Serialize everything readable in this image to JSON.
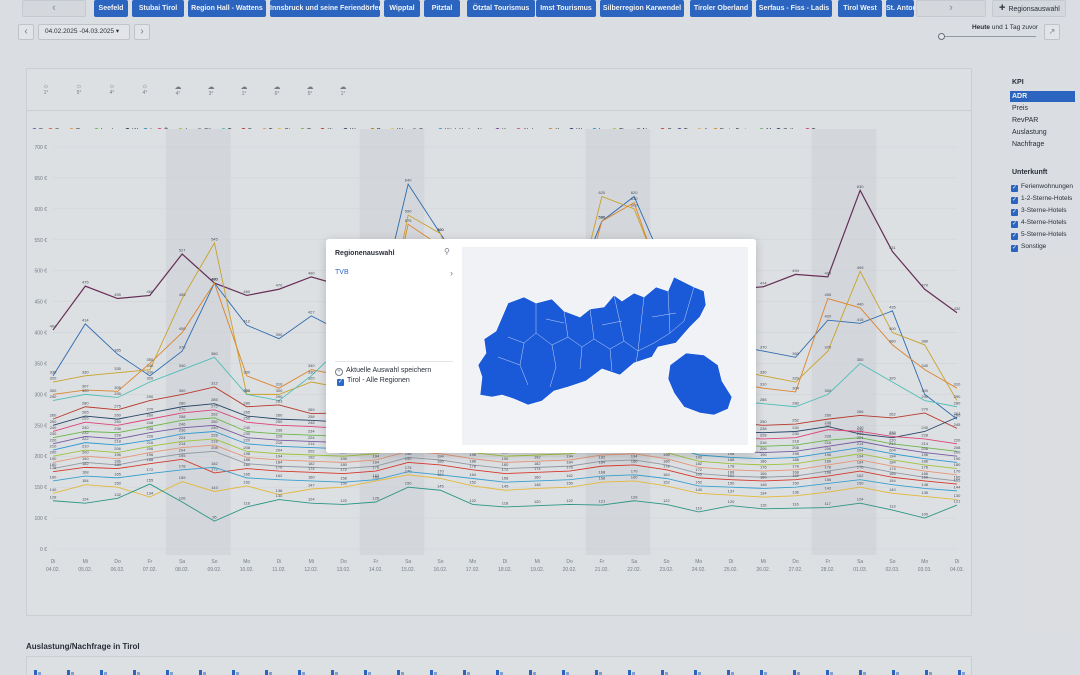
{
  "region_bar": {
    "prev_arrow": "‹",
    "next_arrow": "›",
    "regions": [
      "Seefeld",
      "Stubai Tirol",
      "Region Hall - Wattens",
      "Innsbruck und seine Feriendörfer",
      "Wipptal",
      "Pitztal",
      "Ötztal Tourismus",
      "Imst Tourismus",
      "Silberregion Karwendel",
      "Tiroler Oberland",
      "Serfaus - Fiss - Ladis",
      "Tirol West",
      "St. Anton"
    ],
    "add_button_label": "Regionsauswahl"
  },
  "date_nav": {
    "range_label": "04.02.2025 -04.03.2025",
    "prev": "‹",
    "next": "›"
  },
  "slider": {
    "label_bold": "Heute",
    "label_rest": " und 1 Tag zuvor",
    "value": 0
  },
  "weather": [
    {
      "icon": "☼",
      "temp": "1°"
    },
    {
      "icon": "☼",
      "temp": "5°"
    },
    {
      "icon": "☼",
      "temp": "4°"
    },
    {
      "icon": "☼",
      "temp": "4°"
    },
    {
      "icon": "☁",
      "temp": "4°"
    },
    {
      "icon": "☁",
      "temp": "3°"
    },
    {
      "icon": "☁",
      "temp": "1°"
    },
    {
      "icon": "☁",
      "temp": "6°"
    },
    {
      "icon": "☁",
      "temp": "5°"
    },
    {
      "icon": "☁",
      "temp": "1°"
    }
  ],
  "legend": [
    {
      "label": "E",
      "color": "#7b5ea7"
    },
    {
      "label": "S...",
      "color": "#e8603c"
    },
    {
      "label": "Re...",
      "color": "#f0a236"
    },
    {
      "label": "Innsb...",
      "color": "#6fbf4a"
    },
    {
      "label": "W",
      "color": "#27466b"
    },
    {
      "label": "I",
      "color": "#2f8fd0"
    },
    {
      "label": "Ö...",
      "color": "#e8467c"
    },
    {
      "label": "I...",
      "color": "#a6cc3a"
    },
    {
      "label": "Sil...",
      "color": "#9aa0ab"
    },
    {
      "label": "T...",
      "color": "#53c7c2"
    },
    {
      "label": "S...",
      "color": "#c0392b"
    },
    {
      "label": "T",
      "color": "#f29c7a"
    },
    {
      "label": "St...",
      "color": "#f0c13a"
    },
    {
      "label": "P...",
      "color": "#7fbf3f"
    },
    {
      "label": "Ki...",
      "color": "#c23b22"
    },
    {
      "label": "Kitz...",
      "color": "#3a4a7a"
    },
    {
      "label": "P...",
      "color": "#b8860b"
    },
    {
      "label": "W...",
      "color": "#e6d44a"
    },
    {
      "label": "Fer...",
      "color": "#9aa0ab"
    },
    {
      "label": "Kitzbüheler Alp...",
      "color": "#3aa6d8"
    },
    {
      "label": "K...",
      "color": "#7a3fb0"
    },
    {
      "label": "Alpba...",
      "color": "#e05a8a"
    },
    {
      "label": "K...",
      "color": "#e08a2c"
    },
    {
      "label": "W...",
      "color": "#243b7a"
    },
    {
      "label": "L...",
      "color": "#2fa0d8"
    },
    {
      "label": "Tir...",
      "color": "#b6d23a"
    },
    {
      "label": "Na...",
      "color": "#7a8390"
    },
    {
      "label": "O",
      "color": "#e0392b"
    },
    {
      "label": "T...",
      "color": "#5b4fa8"
    },
    {
      "label": "A",
      "color": "#f4b860"
    },
    {
      "label": "Erste Ferie...",
      "color": "#f08a24"
    },
    {
      "label": "M",
      "color": "#6cbf6a"
    },
    {
      "label": "Zell ...",
      "color": "#2d4a78"
    },
    {
      "label": "T...",
      "color": "#e0407c"
    }
  ],
  "chart_data": {
    "type": "line",
    "title": "",
    "xlabel": "",
    "ylabel": "",
    "ylim": [
      0,
      700
    ],
    "yticks": [
      "0 €",
      "100 €",
      "150 €",
      "200 €",
      "250 €",
      "300 €",
      "350 €",
      "400 €",
      "450 €",
      "500 €",
      "550 €",
      "600 €",
      "650 €",
      "700 €"
    ],
    "ytick_values": [
      50,
      100,
      150,
      200,
      250,
      300,
      350,
      400,
      450,
      500,
      550,
      600,
      650,
      700
    ],
    "x": [
      {
        "day": "Di",
        "date": "04.02."
      },
      {
        "day": "Mi",
        "date": "05.02."
      },
      {
        "day": "Do",
        "date": "06.02."
      },
      {
        "day": "Fr",
        "date": "07.02."
      },
      {
        "day": "Sa",
        "date": "08.02."
      },
      {
        "day": "So",
        "date": "09.02."
      },
      {
        "day": "Mo",
        "date": "10.02."
      },
      {
        "day": "Di",
        "date": "11.02."
      },
      {
        "day": "Mi",
        "date": "12.02."
      },
      {
        "day": "Do",
        "date": "13.02."
      },
      {
        "day": "Fr",
        "date": "14.02."
      },
      {
        "day": "Sa",
        "date": "15.02."
      },
      {
        "day": "So",
        "date": "16.02."
      },
      {
        "day": "Mo",
        "date": "17.02."
      },
      {
        "day": "Di",
        "date": "18.02."
      },
      {
        "day": "Mi",
        "date": "19.02."
      },
      {
        "day": "Do",
        "date": "20.02."
      },
      {
        "day": "Fr",
        "date": "21.02."
      },
      {
        "day": "Sa",
        "date": "22.02."
      },
      {
        "day": "So",
        "date": "23.02."
      },
      {
        "day": "Mo",
        "date": "24.02."
      },
      {
        "day": "Di",
        "date": "25.02."
      },
      {
        "day": "Mi",
        "date": "26.02."
      },
      {
        "day": "Do",
        "date": "27.02."
      },
      {
        "day": "Fr",
        "date": "28.02."
      },
      {
        "day": "Sa",
        "date": "01.03."
      },
      {
        "day": "So",
        "date": "02.03."
      },
      {
        "day": "Mo",
        "date": "03.03."
      },
      {
        "day": "Di",
        "date": "04.03."
      }
    ],
    "series": [
      {
        "color": "#6b2e5a",
        "values": [
          404,
          475,
          455,
          460,
          527,
          480,
          460,
          470,
          490,
          475,
          480,
          500,
          520,
          510,
          500,
          505,
          510,
          520,
          515,
          500,
          460,
          470,
          474,
          494,
          490,
          630,
          531,
          470,
          432
        ]
      },
      {
        "color": "#2f6fb8",
        "values": [
          330,
          414,
          365,
          330,
          370,
          480,
          412,
          390,
          427,
          400,
          420,
          640,
          560,
          480,
          430,
          440,
          450,
          580,
          620,
          500,
          400,
          380,
          370,
          360,
          420,
          415,
          435,
          300,
          260
        ]
      },
      {
        "color": "#d4a92a",
        "values": [
          320,
          330,
          335,
          340,
          455,
          545,
          300,
          300,
          320,
          310,
          330,
          590,
          560,
          420,
          380,
          400,
          410,
          620,
          600,
          470,
          360,
          340,
          330,
          320,
          370,
          499,
          400,
          380,
          290
        ]
      },
      {
        "color": "#e88a2c",
        "values": [
          300,
          307,
          305,
          350,
          400,
          480,
          330,
          310,
          340,
          330,
          340,
          575,
          540,
          400,
          370,
          380,
          390,
          580,
          610,
          460,
          340,
          320,
          310,
          304,
          455,
          440,
          380,
          340,
          310
        ]
      },
      {
        "color": "#53c7c2",
        "values": [
          290,
          300,
          295,
          320,
          340,
          360,
          300,
          290,
          330,
          380,
          360,
          370,
          350,
          330,
          320,
          330,
          335,
          340,
          345,
          330,
          300,
          290,
          285,
          280,
          300,
          350,
          320,
          290,
          280
        ]
      },
      {
        "color": "#c0392b",
        "values": [
          260,
          280,
          275,
          290,
          300,
          312,
          280,
          283,
          269,
          270,
          275,
          300,
          290,
          280,
          270,
          275,
          280,
          290,
          295,
          280,
          260,
          255,
          250,
          252,
          260,
          266,
          262,
          270,
          245
        ]
      },
      {
        "color": "#27466b",
        "values": [
          250,
          265,
          260,
          270,
          280,
          285,
          265,
          260,
          258,
          255,
          260,
          275,
          270,
          262,
          255,
          258,
          260,
          268,
          270,
          262,
          245,
          240,
          238,
          240,
          248,
          236,
          230,
          240,
          263
        ]
      },
      {
        "color": "#e8467c",
        "values": [
          240,
          255,
          250,
          260,
          270,
          275,
          255,
          250,
          248,
          245,
          250,
          265,
          260,
          252,
          245,
          248,
          250,
          258,
          260,
          252,
          235,
          230,
          228,
          230,
          243,
          240,
          232,
          228,
          220
        ]
      },
      {
        "color": "#6fbf4a",
        "values": [
          230,
          240,
          238,
          248,
          258,
          262,
          240,
          236,
          234,
          232,
          236,
          250,
          246,
          238,
          232,
          234,
          236,
          244,
          246,
          238,
          222,
          218,
          216,
          218,
          226,
          230,
          220,
          214,
          208
        ]
      },
      {
        "color": "#7b5ea7",
        "values": [
          220,
          232,
          228,
          238,
          246,
          250,
          230,
          226,
          224,
          222,
          226,
          240,
          236,
          228,
          222,
          224,
          226,
          234,
          236,
          228,
          212,
          208,
          206,
          208,
          216,
          224,
          214,
          206,
          200
        ]
      },
      {
        "color": "#2fa0d8",
        "values": [
          210,
          222,
          218,
          226,
          236,
          240,
          220,
          216,
          214,
          212,
          216,
          230,
          226,
          218,
          212,
          214,
          216,
          224,
          226,
          218,
          202,
          198,
          196,
          198,
          206,
          214,
          204,
          196,
          190
        ]
      },
      {
        "color": "#a6cc3a",
        "values": [
          200,
          210,
          206,
          216,
          224,
          228,
          208,
          204,
          202,
          200,
          204,
          218,
          214,
          206,
          200,
          202,
          204,
          212,
          214,
          206,
          192,
          188,
          186,
          188,
          196,
          204,
          194,
          186,
          180
        ]
      },
      {
        "color": "#f29c7a",
        "values": [
          190,
          200,
          196,
          206,
          214,
          218,
          198,
          194,
          192,
          190,
          194,
          208,
          204,
          196,
          190,
          192,
          194,
          202,
          204,
          196,
          182,
          178,
          176,
          178,
          186,
          194,
          184,
          176,
          170
        ]
      },
      {
        "color": "#9aa0ab",
        "values": [
          180,
          190,
          186,
          196,
          204,
          208,
          188,
          184,
          182,
          180,
          184,
          198,
          194,
          186,
          180,
          182,
          184,
          192,
          194,
          186,
          172,
          168,
          166,
          168,
          176,
          184,
          174,
          166,
          160
        ]
      },
      {
        "color": "#e0392b",
        "values": [
          175,
          182,
          180,
          188,
          195,
          173,
          180,
          176,
          174,
          172,
          176,
          190,
          186,
          178,
          172,
          174,
          176,
          184,
          186,
          178,
          165,
          162,
          160,
          162,
          168,
          176,
          166,
          160,
          155
        ]
      },
      {
        "color": "#3aa6d8",
        "values": [
          160,
          168,
          165,
          172,
          178,
          182,
          165,
          162,
          160,
          158,
          162,
          175,
          170,
          164,
          158,
          160,
          162,
          168,
          170,
          164,
          152,
          150,
          148,
          150,
          156,
          162,
          154,
          148,
          144
        ]
      },
      {
        "color": "#f0c13a",
        "values": [
          140,
          154,
          150,
          134,
          159,
          143,
          152,
          138,
          147,
          150,
          160,
          170,
          164,
          152,
          145,
          148,
          150,
          158,
          160,
          152,
          140,
          137,
          134,
          136,
          142,
          150,
          140,
          135,
          130
        ]
      },
      {
        "color": "#2d9c8c",
        "values": [
          128,
          124,
          132,
          155,
          126,
          95,
          118,
          130,
          124,
          122,
          126,
          150,
          145,
          122,
          118,
          120,
          122,
          121,
          128,
          122,
          110,
          120,
          115,
          116,
          117,
          124,
          113,
          100,
          121
        ]
      }
    ]
  },
  "bottom_section_title": "Auslastung/Nachfrage in Tirol",
  "sidebar": {
    "kpi_title": "KPI",
    "kpi_items": [
      "ADR",
      "Preis",
      "RevPAR",
      "Auslastung",
      "Nachfrage"
    ],
    "kpi_active": "ADR",
    "accommodation_title": "Unterkunft",
    "accommodation_items": [
      "Ferienwohnungen",
      "1-2-Sterne-Hotels",
      "3-Sterne-Hotels",
      "4-Sterne-Hotels",
      "5-Sterne-Hotels",
      "Sonstige"
    ]
  },
  "modal": {
    "title": "Regionenauswahl",
    "tvb_label": "TVB",
    "save_label": "Aktuelle Auswahl speichern",
    "all_regions_label": "Tirol - Alle Regionen",
    "map_color": "#1a5ad8"
  }
}
